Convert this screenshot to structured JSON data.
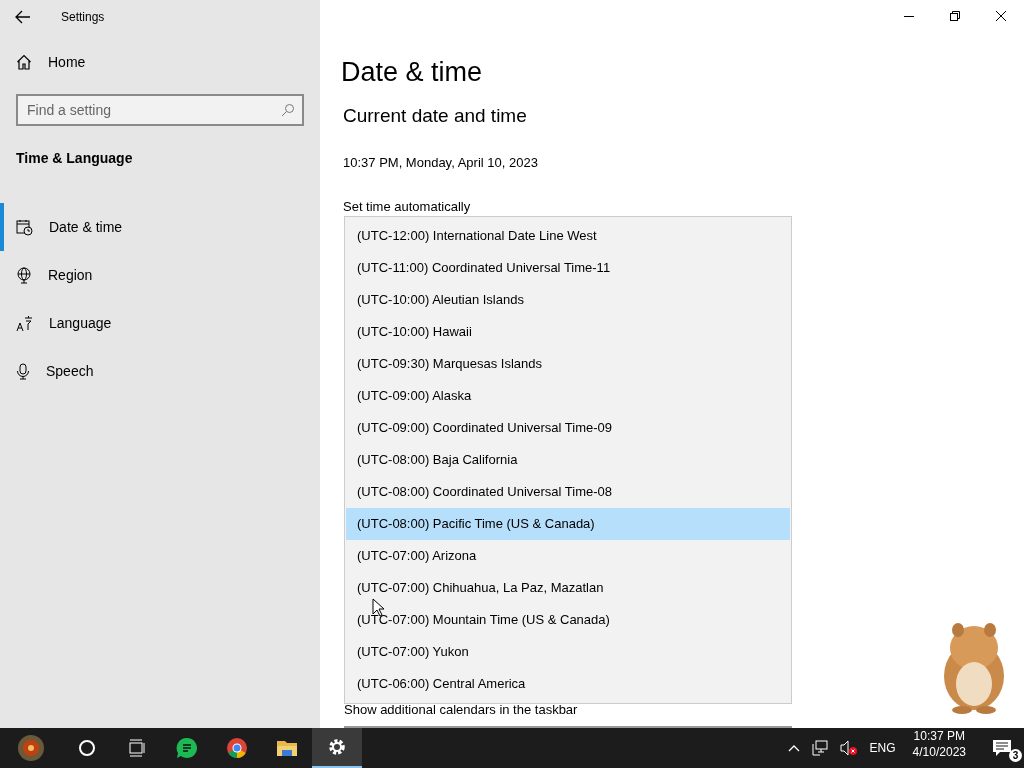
{
  "window": {
    "title": "Settings"
  },
  "sidebar": {
    "home": "Home",
    "search": {
      "placeholder": "Find a setting"
    },
    "section": "Time & Language",
    "items": [
      {
        "label": "Date & time",
        "kind": "calendar",
        "selected": true
      },
      {
        "label": "Region",
        "kind": "globe",
        "selected": false
      },
      {
        "label": "Language",
        "kind": "language",
        "selected": false
      },
      {
        "label": "Speech",
        "kind": "microphone",
        "selected": false
      }
    ]
  },
  "page": {
    "title": "Date & time",
    "heading": "Current date and time",
    "current": "10:37 PM, Monday, April 10, 2023",
    "set_time_label": "Set time automatically",
    "calendars_label": "Show additional calendars in the taskbar"
  },
  "timezone_dropdown": {
    "options": [
      {
        "label": "(UTC-12:00) International Date Line West",
        "selected": false
      },
      {
        "label": "(UTC-11:00) Coordinated Universal Time-11",
        "selected": false
      },
      {
        "label": "(UTC-10:00) Aleutian Islands",
        "selected": false
      },
      {
        "label": "(UTC-10:00) Hawaii",
        "selected": false
      },
      {
        "label": "(UTC-09:30) Marquesas Islands",
        "selected": false
      },
      {
        "label": "(UTC-09:00) Alaska",
        "selected": false
      },
      {
        "label": "(UTC-09:00) Coordinated Universal Time-09",
        "selected": false
      },
      {
        "label": "(UTC-08:00) Baja California",
        "selected": false
      },
      {
        "label": "(UTC-08:00) Coordinated Universal Time-08",
        "selected": false
      },
      {
        "label": "(UTC-08:00) Pacific Time (US & Canada)",
        "selected": true
      },
      {
        "label": "(UTC-07:00) Arizona",
        "selected": false
      },
      {
        "label": "(UTC-07:00) Chihuahua, La Paz, Mazatlan",
        "selected": false
      },
      {
        "label": "(UTC-07:00) Mountain Time (US & Canada)",
        "selected": false
      },
      {
        "label": "(UTC-07:00) Yukon",
        "selected": false
      },
      {
        "label": "(UTC-06:00) Central America",
        "selected": false
      }
    ]
  },
  "taskbar": {
    "apps": [
      {
        "kind": "start",
        "selected": false
      },
      {
        "kind": "search",
        "selected": false
      },
      {
        "kind": "taskview",
        "selected": false
      },
      {
        "kind": "chat",
        "selected": false
      },
      {
        "kind": "browser",
        "selected": false
      },
      {
        "kind": "folder",
        "selected": false
      },
      {
        "kind": "settings",
        "selected": true
      }
    ],
    "tray": {
      "language": "ENG",
      "time": "10:37 PM",
      "date": "4/10/2023",
      "notifications": "3"
    }
  }
}
